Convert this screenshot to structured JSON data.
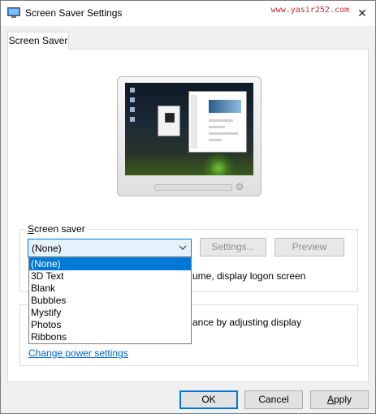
{
  "window": {
    "title": "Screen Saver Settings",
    "watermark": "www.yasir252.com",
    "close_icon": "close-icon",
    "app_icon": "screen-saver-app-icon"
  },
  "tabs": [
    {
      "label": "Screen Saver",
      "active": true
    }
  ],
  "screen_saver": {
    "group_label": "Screen saver",
    "group_label_parts": [
      "S",
      "creen saver"
    ],
    "selected": "(None)",
    "settings_button": "Settings...",
    "preview_button": "Preview",
    "resume_text": "ume, display logon screen",
    "options": [
      "(None)",
      "3D Text",
      "Blank",
      "Bubbles",
      "Mystify",
      "Photos",
      "Ribbons"
    ]
  },
  "power": {
    "text": "ance by adjusting display",
    "link": "Change power settings"
  },
  "footer": {
    "ok": "OK",
    "cancel": "Cancel",
    "apply": "Apply",
    "apply_parts": [
      "A",
      "pply"
    ]
  },
  "colors": {
    "accent": "#0078d7",
    "link": "#0066cc",
    "watermark": "#cc2a2a"
  }
}
